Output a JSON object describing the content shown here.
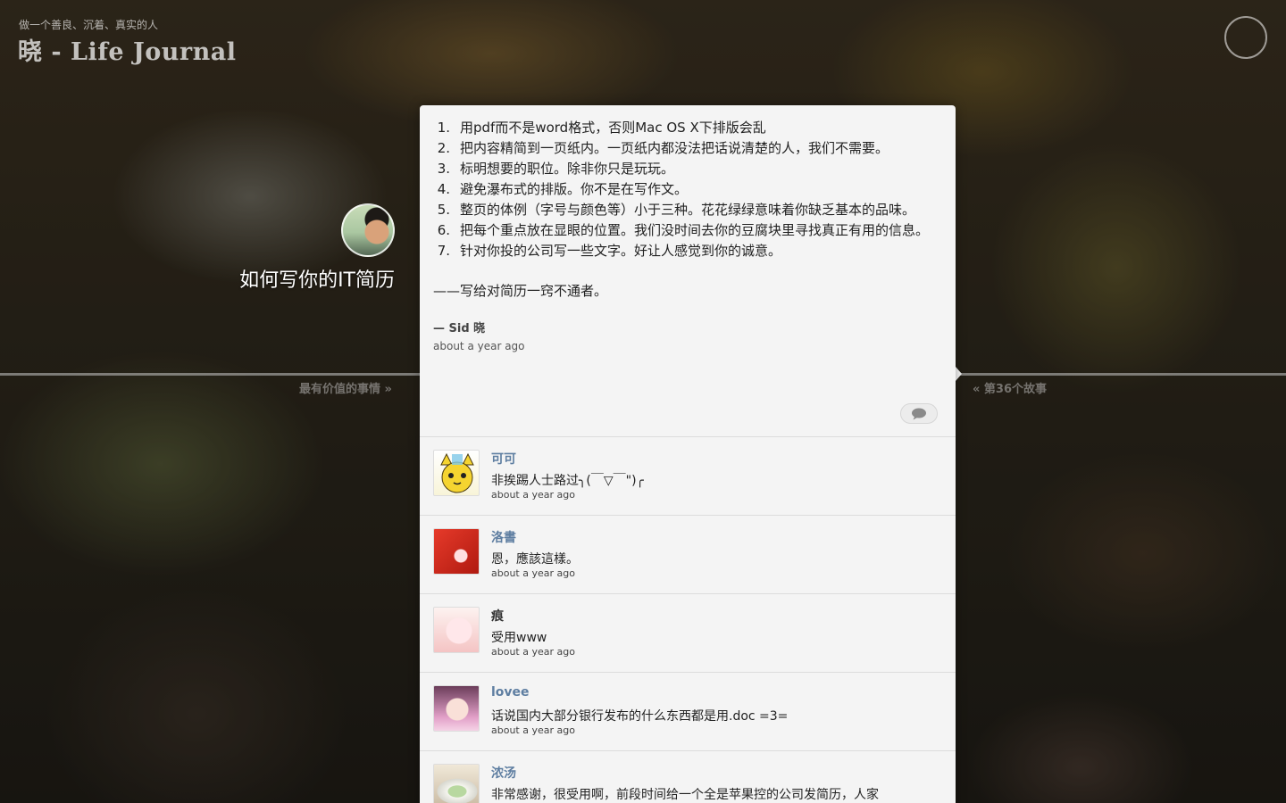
{
  "site": {
    "tagline": "做一个善良、沉着、真实的人",
    "title": "晓 - Life Journal"
  },
  "timeline": {
    "prev_label": "最有价值的事情 »",
    "next_label": "« 第36个故事"
  },
  "story": {
    "title": "如何写你的IT简历",
    "items": [
      {
        "num": "1.",
        "text": "用pdf而不是word格式，否则Mac OS X下排版会乱"
      },
      {
        "num": "2.",
        "text": "把内容精简到一页纸内。一页纸内都没法把话说清楚的人，我们不需要。"
      },
      {
        "num": "3.",
        "text": "标明想要的职位。除非你只是玩玩。"
      },
      {
        "num": "4.",
        "text": "避免瀑布式的排版。你不是在写作文。"
      },
      {
        "num": "5.",
        "text": "整页的体例（字号与颜色等）小于三种。花花绿绿意味着你缺乏基本的品味。"
      },
      {
        "num": "6.",
        "text": "把每个重点放在显眼的位置。我们没时间去你的豆腐块里寻找真正有用的信息。"
      },
      {
        "num": "7.",
        "text": "针对你投的公司写一些文字。好让人感觉到你的诚意。"
      }
    ],
    "signoff": "——写给对简历一窍不通者。",
    "author": "— Sid 晓",
    "time": "about a year ago"
  },
  "comments": [
    {
      "name": "可可",
      "text": "非挨踢人士路过╮(￣▽￣\")╭",
      "time": "about a year ago"
    },
    {
      "name": "洛書",
      "text": "恩，應該這樣。",
      "time": "about a year ago"
    },
    {
      "name": "痕",
      "text": "受用www",
      "time": "about a year ago"
    },
    {
      "name": "lovee",
      "text": "话说国内大部分银行发布的什么东西都是用.doc =3=",
      "time": "about a year ago"
    },
    {
      "name": "浓汤",
      "text": "非常感谢，很受用啊，前段时间给一个全是苹果控的公司发简历，人家",
      "time": "about a year ago"
    }
  ],
  "icons": {
    "menu": "circle-menu-icon",
    "comment": "speech-bubble-icon"
  },
  "colors": {
    "card_bg": "#f4f4f4",
    "comment_name": "#5e7ea1"
  }
}
